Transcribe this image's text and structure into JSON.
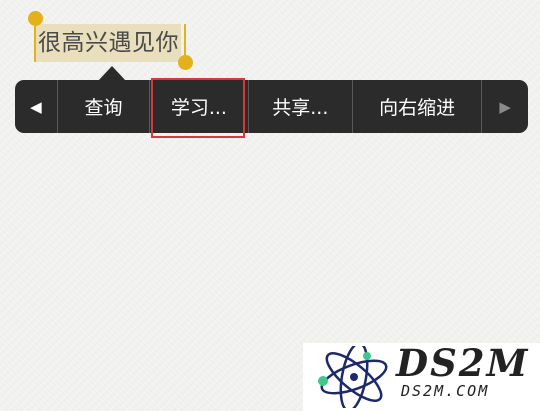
{
  "selection": {
    "text": "很高兴遇见你"
  },
  "menu": {
    "prev_icon": "◀",
    "next_icon": "▶",
    "items": [
      "查询",
      "学习...",
      "共享...",
      "向右缩进"
    ],
    "highlighted_item": "学习..."
  },
  "colors": {
    "selection_bg": "#eadfbd",
    "handle": "#e3b21a",
    "menu_bg": "#2b2b2b",
    "highlight": "#d43a3a"
  },
  "watermark": {
    "title": "DS2M",
    "subtitle": "DS2M.COM",
    "logo_icon": "atom-logo-icon"
  }
}
